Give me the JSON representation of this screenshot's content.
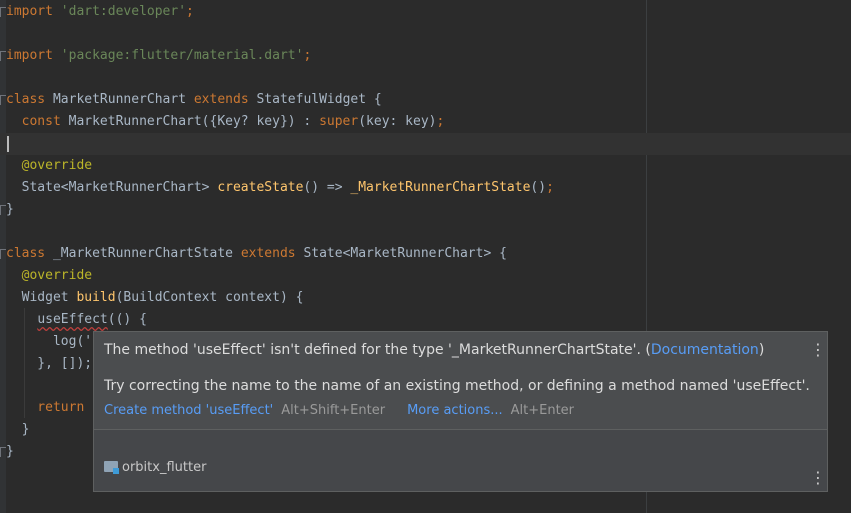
{
  "editor": {
    "lines": [
      {
        "parts": [
          {
            "t": "import ",
            "c": "kw"
          },
          {
            "t": "'dart:developer'",
            "c": "str"
          },
          {
            "t": ";",
            "c": "kw"
          }
        ]
      },
      {
        "parts": []
      },
      {
        "parts": [
          {
            "t": "import ",
            "c": "kw"
          },
          {
            "t": "'package:flutter/material.dart'",
            "c": "str"
          },
          {
            "t": ";",
            "c": "kw"
          }
        ]
      },
      {
        "parts": []
      },
      {
        "parts": [
          {
            "t": "class ",
            "c": "kw"
          },
          {
            "t": "MarketRunnerChart ",
            "c": ""
          },
          {
            "t": "extends ",
            "c": "kw"
          },
          {
            "t": "StatefulWidget {",
            "c": ""
          }
        ]
      },
      {
        "parts": [
          {
            "t": "  const ",
            "c": "kw"
          },
          {
            "t": "MarketRunnerChart({Key? key}) : ",
            "c": ""
          },
          {
            "t": "super",
            "c": "kw"
          },
          {
            "t": "(key: key)",
            "c": ""
          },
          {
            "t": ";",
            "c": "kw"
          }
        ]
      },
      {
        "parts": []
      },
      {
        "parts": [
          {
            "t": "  @override",
            "c": "ann"
          }
        ]
      },
      {
        "parts": [
          {
            "t": "  State<MarketRunnerChart> ",
            "c": ""
          },
          {
            "t": "createState",
            "c": "fn"
          },
          {
            "t": "() => ",
            "c": ""
          },
          {
            "t": "_MarketRunnerChartState",
            "c": "fn"
          },
          {
            "t": "()",
            "c": ""
          },
          {
            "t": ";",
            "c": "kw"
          }
        ]
      },
      {
        "parts": [
          {
            "t": "}",
            "c": ""
          }
        ]
      },
      {
        "parts": []
      },
      {
        "parts": [
          {
            "t": "class ",
            "c": "kw"
          },
          {
            "t": "_MarketRunnerChartState ",
            "c": ""
          },
          {
            "t": "extends ",
            "c": "kw"
          },
          {
            "t": "State<MarketRunnerChart> {",
            "c": ""
          }
        ]
      },
      {
        "parts": [
          {
            "t": "  @override",
            "c": "ann"
          }
        ]
      },
      {
        "parts": [
          {
            "t": "  Widget ",
            "c": ""
          },
          {
            "t": "build",
            "c": "fn"
          },
          {
            "t": "(BuildContext context) {",
            "c": ""
          }
        ]
      },
      {
        "parts": [
          {
            "t": "    ",
            "c": ""
          },
          {
            "t": "useEffect",
            "c": "err"
          },
          {
            "t": "(() {",
            "c": ""
          }
        ]
      },
      {
        "parts": [
          {
            "t": "      log('",
            "c": ""
          }
        ]
      },
      {
        "parts": [
          {
            "t": "    }, []);",
            "c": ""
          }
        ]
      },
      {
        "parts": []
      },
      {
        "parts": [
          {
            "t": "    return",
            "c": "kw"
          }
        ]
      },
      {
        "parts": [
          {
            "t": "  }",
            "c": ""
          }
        ]
      },
      {
        "parts": [
          {
            "t": "}",
            "c": ""
          }
        ]
      }
    ]
  },
  "popup": {
    "message_prefix": "The method 'useEffect' isn't defined for the type '_MarketRunnerChartState'. (",
    "documentation_link": "Documentation",
    "message_suffix": ")",
    "hint": "Try correcting the name to the name of an existing method, or defining a method named 'useEffect'.",
    "create_action": "Create method 'useEffect'",
    "create_shortcut": "Alt+Shift+Enter",
    "more_actions": "More actions...",
    "more_shortcut": "Alt+Enter",
    "module_name": "orbitx_flutter",
    "menu_glyph": "⋮"
  }
}
